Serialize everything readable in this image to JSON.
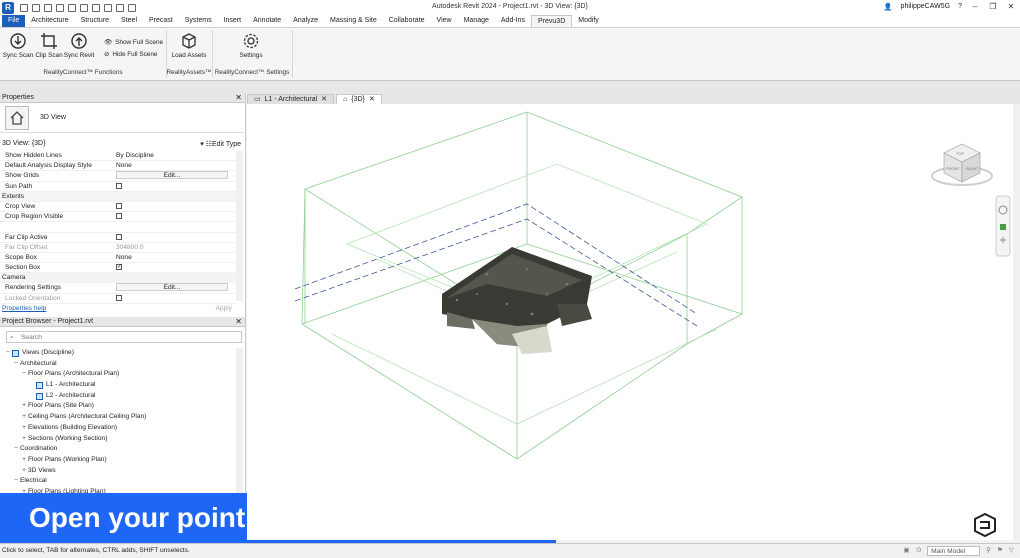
{
  "window": {
    "title": "Autodesk Revit 2024 - Project1.rvt - 3D View: {3D}",
    "user": "philippeCAW5G",
    "help": "?"
  },
  "tabs": [
    "File",
    "Architecture",
    "Structure",
    "Steel",
    "Precast",
    "Systems",
    "Insert",
    "Annotate",
    "Analyze",
    "Massing & Site",
    "Collaborate",
    "View",
    "Manage",
    "Add-Ins",
    "Prevu3D",
    "Modify"
  ],
  "active_tab": "Prevu3D",
  "ribbon": {
    "sync_scan": "Sync Scan",
    "clip_scan": "Clip Scan",
    "sync_revit": "Sync Revit",
    "show_full_scene": "Show Full Scene",
    "hide_full_scene": "Hide Full Scene",
    "load_assets": "Load Assets",
    "settings": "Settings",
    "group_functions": "RealityConnect™ Functions",
    "group_assets": "RealityAssets™",
    "group_settings": "RealityConnect™ Settings"
  },
  "properties": {
    "title": "Properties",
    "type_name": "3D View",
    "selector": "3D View: {3D}",
    "edit_type": "Edit Type",
    "rows": [
      {
        "k": "Show Hidden Lines",
        "v": "By Discipline"
      },
      {
        "k": "Default Analysis Display Style",
        "v": "None"
      },
      {
        "k": "Show Grids",
        "v": "Edit..."
      },
      {
        "k": "Sun Path",
        "v": ""
      },
      {
        "k": "Extents",
        "v": ""
      },
      {
        "k": "Crop View",
        "v": ""
      },
      {
        "k": "Crop Region Visible",
        "v": ""
      },
      {
        "k": "",
        "v": ""
      },
      {
        "k": "Far Clip Active",
        "v": ""
      },
      {
        "k": "Far Clip Offset",
        "v": "304800.0"
      },
      {
        "k": "Scope Box",
        "v": "None"
      },
      {
        "k": "Section Box",
        "v": ""
      },
      {
        "k": "Camera",
        "v": ""
      },
      {
        "k": "Rendering Settings",
        "v": "Edit..."
      },
      {
        "k": "Locked Orientation",
        "v": ""
      }
    ],
    "help": "Properties help",
    "apply": "Apply"
  },
  "browser": {
    "title": "Project Browser - Project1.rvt",
    "search_placeholder": "Search",
    "nodes": [
      {
        "label": "Views (Discipline)",
        "indent": 0,
        "exp": "−",
        "icon": true
      },
      {
        "label": "Architectural",
        "indent": 1,
        "exp": "−"
      },
      {
        "label": "Floor Plans (Architectural Plan)",
        "indent": 2,
        "exp": "−"
      },
      {
        "label": "L1 - Architectural",
        "indent": 3,
        "exp": "",
        "icon": true
      },
      {
        "label": "L2 - Architectural",
        "indent": 3,
        "exp": "",
        "icon": true
      },
      {
        "label": "Floor Plans (Site Plan)",
        "indent": 2,
        "exp": "+"
      },
      {
        "label": "Ceiling Plans (Architectural Ceiling Plan)",
        "indent": 2,
        "exp": "+"
      },
      {
        "label": "Elevations (Building Elevation)",
        "indent": 2,
        "exp": "+"
      },
      {
        "label": "Sections (Working Section)",
        "indent": 2,
        "exp": "+"
      },
      {
        "label": "Coordination",
        "indent": 1,
        "exp": "−"
      },
      {
        "label": "Floor Plans (Working Plan)",
        "indent": 2,
        "exp": "+"
      },
      {
        "label": "3D Views",
        "indent": 2,
        "exp": "+"
      },
      {
        "label": "Electrical",
        "indent": 1,
        "exp": "−"
      },
      {
        "label": "Floor Plans (Lighting Plan)",
        "indent": 2,
        "exp": "+"
      }
    ]
  },
  "view_tabs": [
    "L1 - Architectural",
    "{3D}"
  ],
  "viewcube": {
    "top": "TOP",
    "front": "FRONT",
    "right": "RIGHT"
  },
  "caption": "Open your point cloud at low density",
  "status": {
    "hint": "Click to select, TAB for alternates, CTRL adds, SHIFT unselects.",
    "model": "Main Model",
    "zero": ":0"
  },
  "colors": {
    "accent": "#1b5fb8",
    "caption": "#1e66f5",
    "box": "#8fd08f"
  }
}
